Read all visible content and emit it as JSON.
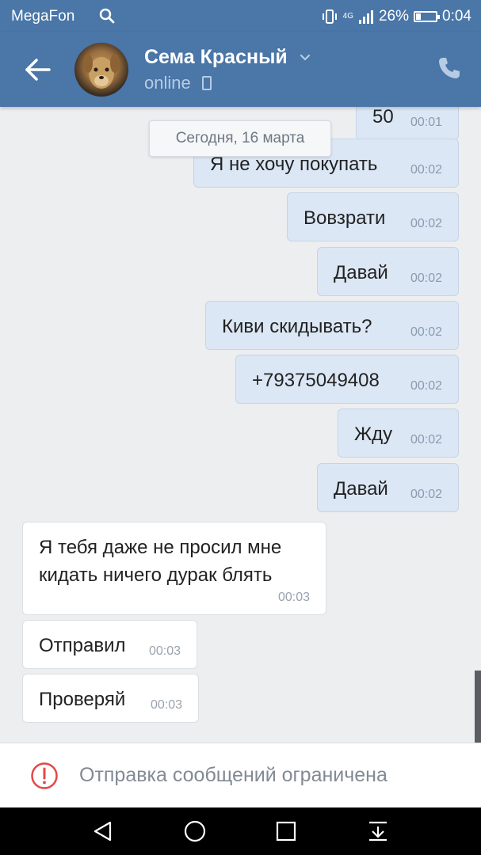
{
  "status_bar": {
    "carrier": "MegaFon",
    "network": "4G",
    "battery_percent": "26%",
    "battery_level": 0.26,
    "time": "0:04"
  },
  "header": {
    "contact_name": "Сема Красный",
    "presence": "online"
  },
  "chat": {
    "date_separator": "Сегодня, 16 марта",
    "messages": [
      {
        "direction": "out",
        "text": "50",
        "time": "00:01"
      },
      {
        "direction": "out",
        "text": "Я не хочу покупать",
        "time": "00:02"
      },
      {
        "direction": "out",
        "text": "Вовзрати",
        "time": "00:02"
      },
      {
        "direction": "out",
        "text": "Давай",
        "time": "00:02"
      },
      {
        "direction": "out",
        "text": "Киви скидывать?",
        "time": "00:02"
      },
      {
        "direction": "out",
        "text": "+79375049408",
        "time": "00:02",
        "is_link": true
      },
      {
        "direction": "out",
        "text": "Жду",
        "time": "00:02"
      },
      {
        "direction": "out",
        "text": "Давай",
        "time": "00:02"
      },
      {
        "direction": "in",
        "text_line1": "Я тебя даже не просил мне",
        "text_line2": "кидать ничего дурак блять",
        "time": "00:03"
      },
      {
        "direction": "in",
        "text": "Отправил",
        "time": "00:03"
      },
      {
        "direction": "in",
        "text": "Проверяй",
        "time": "00:03"
      }
    ]
  },
  "restriction": {
    "label": "Отправка сообщений ограничена",
    "icon": "alert-circle-icon"
  },
  "colors": {
    "header_bg": "#4a76a8",
    "outgoing_bubble": "#dce7f5",
    "incoming_bubble": "#ffffff",
    "chat_bg": "#edeef0",
    "alert_red": "#e64646"
  }
}
